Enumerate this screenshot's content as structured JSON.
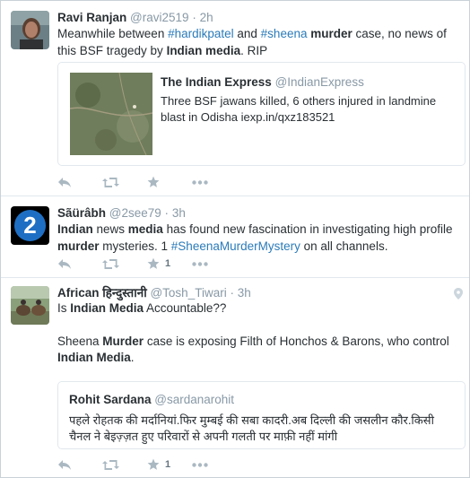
{
  "tweets": [
    {
      "fullname": "Ravi Ranjan",
      "username": "@ravi2519",
      "dot": "·",
      "time": "2h",
      "text_parts": [
        "Meanwhile between ",
        "#hardikpatel",
        " and ",
        "#sheena",
        " ",
        "murder",
        " case, no news of this BSF tragedy by ",
        "Indian media",
        ". RIP"
      ],
      "quoted": {
        "name": "The Indian Express",
        "handle": "@IndianExpress",
        "text": "Three BSF jawans killed, 6 others injured in landmine blast in Odisha iexp.in/qxz183521"
      }
    },
    {
      "fullname": "Sãürâbh",
      "username": "@2see79",
      "dot": "·",
      "time": "3h",
      "avatar_glyph": "2",
      "text_parts": [
        "Indian",
        " news ",
        "media",
        " has found new fascination in investigating high profile ",
        "murder",
        " mysteries. 1 ",
        "#SheenaMurderMystery",
        " on all channels."
      ],
      "favorite_count": "1"
    },
    {
      "fullname": "African हिन्दुस्तानी",
      "username": "@Tosh_Tiwari",
      "dot": "·",
      "time": "3h",
      "text_line1_parts": [
        "Is ",
        "Indian Media",
        " Accountable??"
      ],
      "text_line2_parts": [
        "Sheena ",
        "Murder",
        " case is exposing Filth of Honchos & Barons, who control ",
        "Indian Media",
        "."
      ],
      "quoted": {
        "name": "Rohit Sardana",
        "handle": "@sardanarohit",
        "text": "पहले रोहतक की मर्दानियां.फिर मुम्बई की सबा कादरी.अब दिल्ली की जसलीन कौर.किसी चैनल ने बेइज़्ज़त हुए परिवारों से अपनी गलती पर माफ़ी नहीं मांगी"
      },
      "favorite_count": "1"
    }
  ],
  "icons": [
    "reply-icon",
    "retweet-icon",
    "favorite-icon",
    "more-icon",
    "location-pin-icon"
  ],
  "colors": {
    "link": "#2b7bb9",
    "muted": "#8899a6",
    "action": "#aab8c2",
    "text": "#292f33",
    "border": "#e1e8ed"
  }
}
